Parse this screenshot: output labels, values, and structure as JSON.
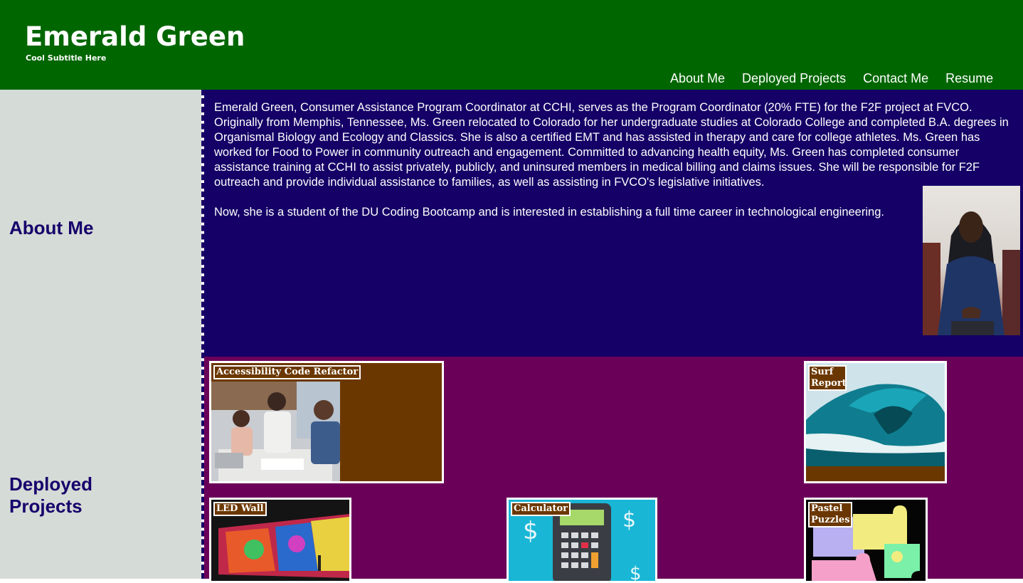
{
  "header": {
    "title": "Emerald Green",
    "subtitle": "Cool Subtitle Here",
    "nav": [
      "About Me",
      "Deployed Projects",
      "Contact Me",
      "Resume"
    ]
  },
  "sidebar": {
    "about_heading": "About Me",
    "projects_heading": "Deployed Projects"
  },
  "about": {
    "paragraph1": "Emerald Green, Consumer Assistance Program Coordinator at CCHI, serves as the Program Coordinator (20% FTE) for the F2F project at FVCO. Originally from Memphis, Tennessee, Ms. Green relocated to Colorado for her undergraduate studies at Colorado College and completed B.A. degrees in Organismal Biology and Ecology and Classics. She is also a certified EMT and has assisted in therapy and care for college athletes. Ms. Green has worked for Food to Power in community outreach and engagement. Committed to advancing health equity, Ms. Green has completed consumer assistance training at CCHI to assist privately, publicly, and uninsured members in medical billing and claims issues. She will be responsible for F2F outreach and provide individual assistance to families, as well as assisting in FVCO's legislative initiatives.",
    "paragraph2": "Now, she is a student of the DU Coding Bootcamp and is interested in establishing a full time career in technological engineering."
  },
  "projects": [
    {
      "label": "Accessibility Code Refactor",
      "icon": "team-meeting-photo"
    },
    {
      "label": "Surf Report",
      "icon": "ocean-wave-photo"
    },
    {
      "label": "LED Wall",
      "icon": "led-wall-photo"
    },
    {
      "label": "Calculator",
      "icon": "calculator-photo"
    },
    {
      "label": "Pastel Puzzles",
      "icon": "puzzle-pieces-photo"
    }
  ],
  "colors": {
    "header": "#006600",
    "sidebar": "#d5dbd6",
    "about_bg": "#140066",
    "projects_bg": "#6b0059",
    "card_bg": "#6b3700",
    "heading": "#16006b"
  }
}
